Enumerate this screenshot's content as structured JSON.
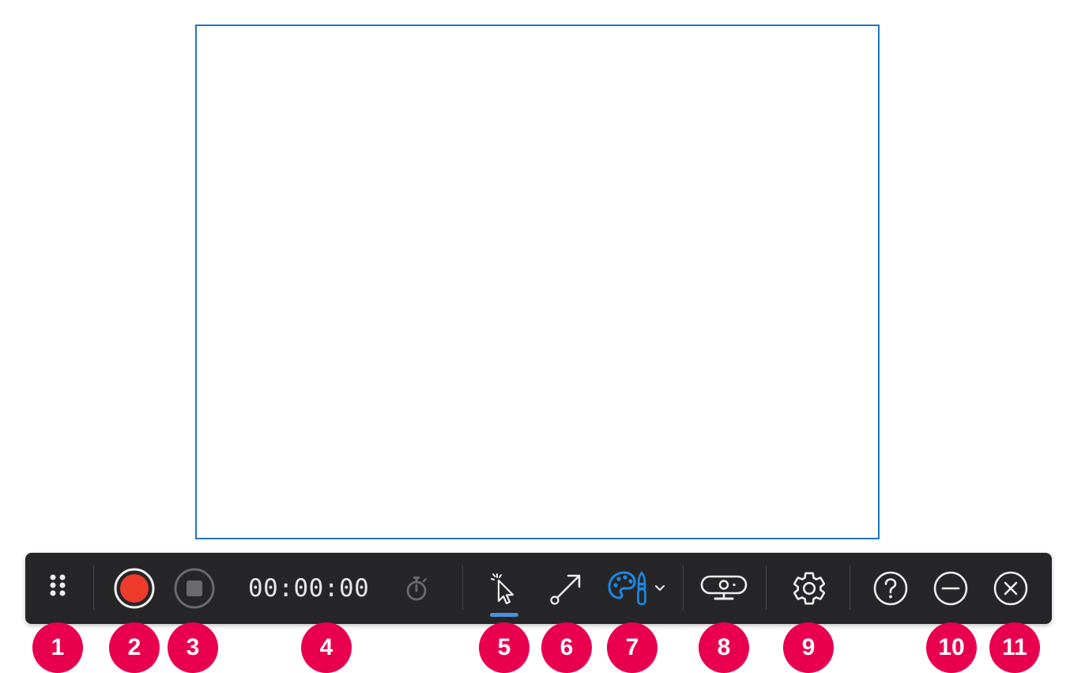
{
  "timer": {
    "value": "00:00:00"
  },
  "toolbar_items": [
    {
      "icon": "drag-handle-icon"
    },
    {
      "icon": "record-icon",
      "color": "#ef3b2c"
    },
    {
      "icon": "stop-icon"
    },
    {
      "icon": "stopwatch-icon"
    },
    {
      "icon": "cursor-highlight-icon",
      "active": true,
      "accent": "#4a90d9"
    },
    {
      "icon": "arrow-annotation-icon"
    },
    {
      "icon": "palette-brush-icon",
      "color": "#1e88e5"
    },
    {
      "icon": "chevron-down-icon"
    },
    {
      "icon": "webcam-icon"
    },
    {
      "icon": "gear-icon"
    },
    {
      "icon": "help-icon"
    },
    {
      "icon": "minimize-icon"
    },
    {
      "icon": "close-icon"
    }
  ],
  "callouts": [
    "1",
    "2",
    "3",
    "4",
    "5",
    "6",
    "7",
    "8",
    "9",
    "10",
    "11"
  ],
  "colors": {
    "toolbar_bg": "#262628",
    "capture_border": "#1f74c7",
    "callout_bg": "#e8004f",
    "record_red": "#ef3b2c",
    "accent_blue": "#4a90d9"
  }
}
